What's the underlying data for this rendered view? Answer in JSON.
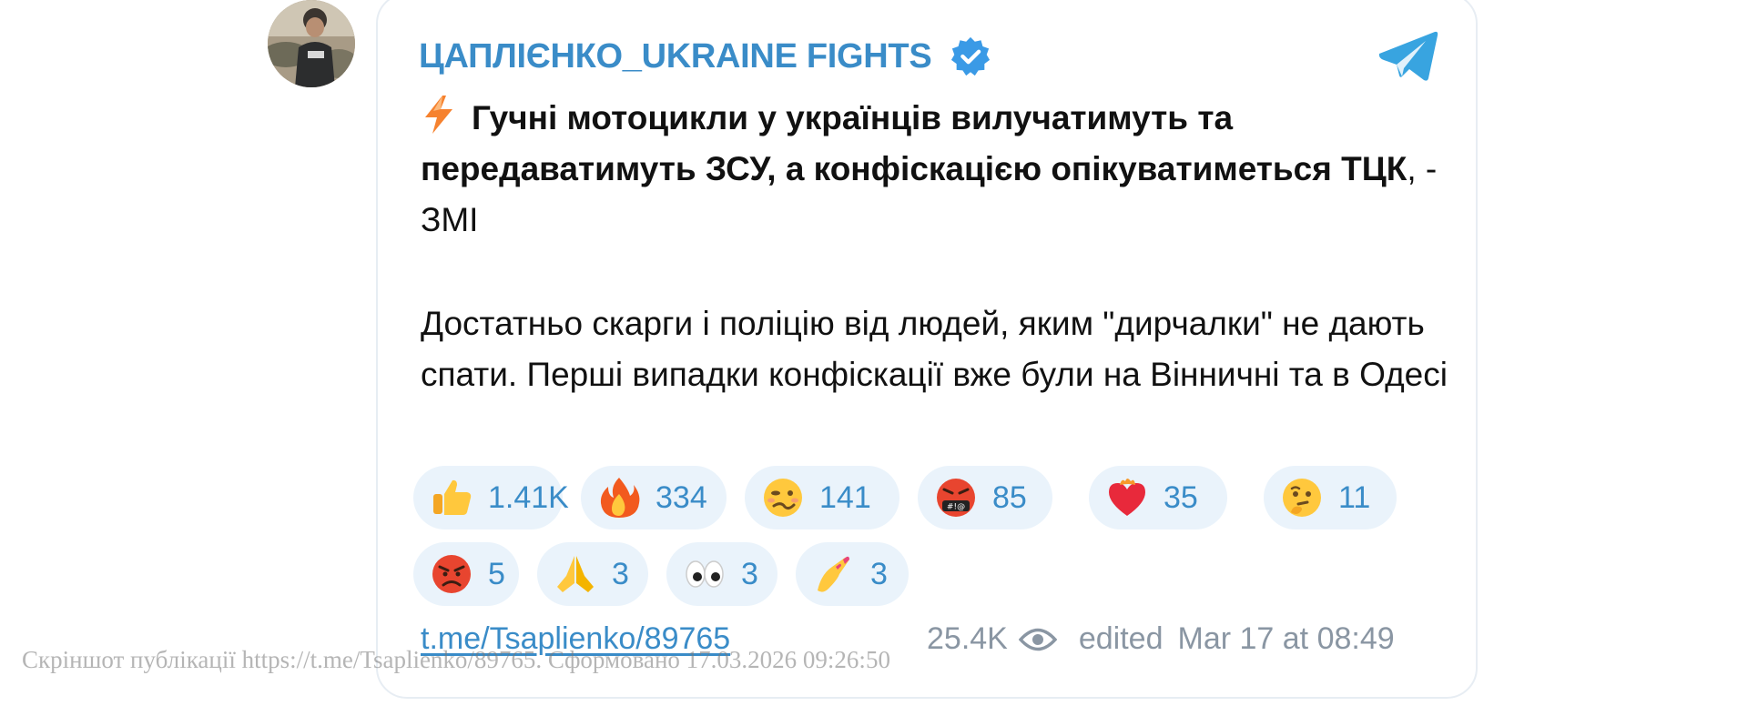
{
  "post": {
    "channel_name": "ЦАПЛІЄНКО_UKRAINE FIGHTS",
    "headline_bold": "Гучні мотоцикли у українців вилучатимуть та передаватимуть ЗСУ, а конфіскацією опікуватиметься ТЦК",
    "headline_tail": ", - ЗМІ",
    "body": "Достатньо скарги і поліцію від людей, яким \"дирчалки\" не дають спати. Перші випадки конфіскації вже були на Вінничні та в Одесі",
    "link": "t.me/Tsaplienko/89765",
    "views": "25.4K",
    "edited_label": "edited",
    "date": "Mar 17 at 08:49"
  },
  "reactions": [
    {
      "icon": "thumbs-up-icon",
      "count": "1.41K"
    },
    {
      "icon": "fire-icon",
      "count": "334"
    },
    {
      "icon": "woozy-face-icon",
      "count": "141"
    },
    {
      "icon": "cursing-face-icon",
      "count": "85"
    },
    {
      "icon": "heart-on-fire-icon",
      "count": "35"
    },
    {
      "icon": "thinking-face-icon",
      "count": "11"
    },
    {
      "icon": "angry-face-icon",
      "count": "5"
    },
    {
      "icon": "folded-hands-icon",
      "count": "3"
    },
    {
      "icon": "eyes-icon",
      "count": "3"
    },
    {
      "icon": "nail-polish-icon",
      "count": "3"
    }
  ],
  "watermark": "Скріншот публікації https://t.me/Tsaplienko/89765. Сформовано 17.03.2026 09:26:50",
  "colors": {
    "accent": "#3a8cc8",
    "reaction_bg": "#eaf3fb",
    "meta": "#8a96a3",
    "border": "#e7edf3"
  }
}
